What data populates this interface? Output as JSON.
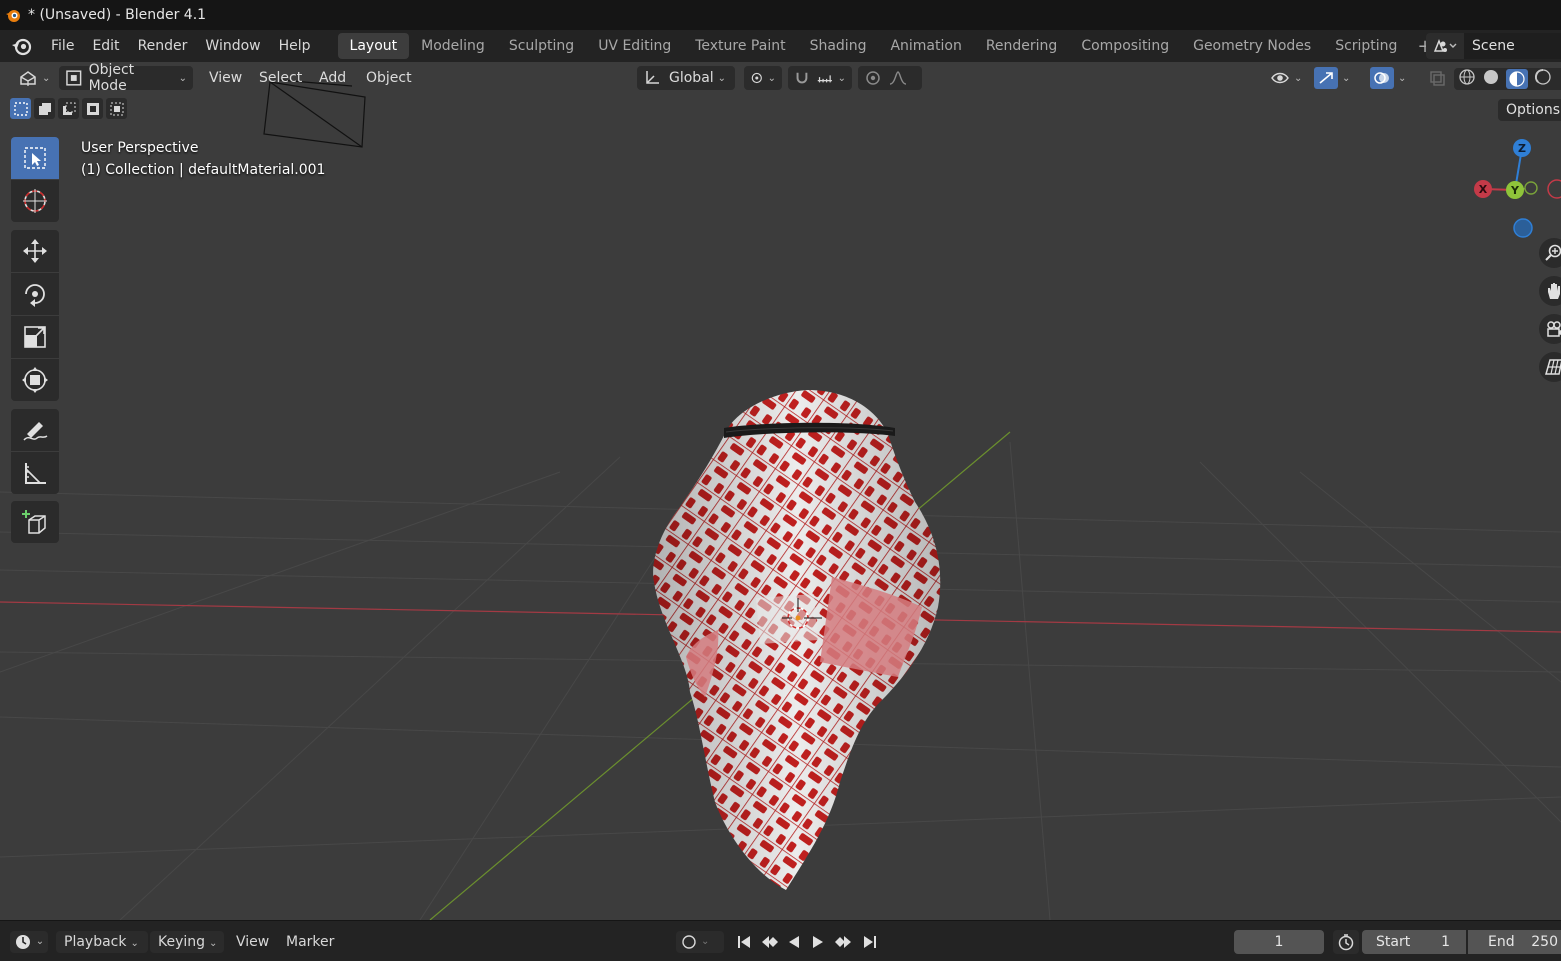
{
  "window": {
    "title": "* (Unsaved) - Blender 4.1"
  },
  "menu": [
    "File",
    "Edit",
    "Render",
    "Window",
    "Help"
  ],
  "workspaces": {
    "active": "Layout",
    "tabs": [
      "Layout",
      "Modeling",
      "Sculpting",
      "UV Editing",
      "Texture Paint",
      "Shading",
      "Animation",
      "Rendering",
      "Compositing",
      "Geometry Nodes",
      "Scripting"
    ]
  },
  "scene": {
    "name": "Scene"
  },
  "viewport_header": {
    "mode": "Object Mode",
    "menus": [
      "View",
      "Select",
      "Add",
      "Object"
    ],
    "orientation": "Global"
  },
  "options_label": "Options",
  "overlay": {
    "view_name": "User Perspective",
    "collection_info": "(1) Collection | defaultMaterial.001"
  },
  "gizmo": {
    "z": "Z",
    "y": "Y",
    "x": "X"
  },
  "timeline": {
    "menus": [
      "Playback",
      "Keying",
      "View",
      "Marker"
    ],
    "current_frame": "1",
    "start_label": "Start",
    "start_value": "1",
    "end_label": "End",
    "end_value": "250"
  },
  "colors": {
    "accent": "#4772b3",
    "viewport_bg": "#3c3c3c",
    "x_axis": "#c43a48",
    "y_axis": "#7aa33a",
    "z_axis": "#2f7fd6",
    "fabric_red": "#c0201f",
    "fabric_white": "#eeeeee"
  }
}
